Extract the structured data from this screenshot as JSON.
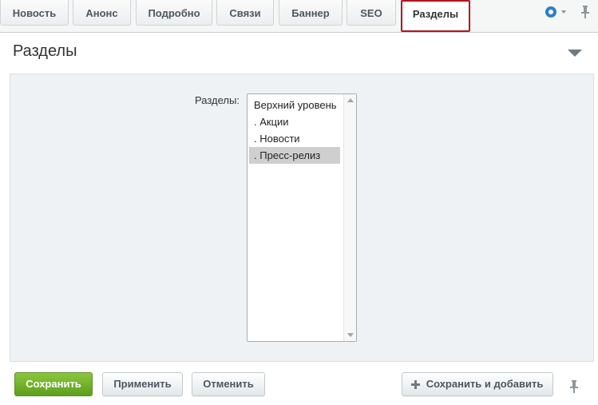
{
  "tabs": [
    {
      "label": "Новость",
      "active": false
    },
    {
      "label": "Анонс",
      "active": false
    },
    {
      "label": "Подробно",
      "active": false
    },
    {
      "label": "Связи",
      "active": false
    },
    {
      "label": "Баннер",
      "active": false
    },
    {
      "label": "SEO",
      "active": false
    },
    {
      "label": "Разделы",
      "active": true
    }
  ],
  "icons": {
    "settings": "gear-icon",
    "pin": "pin-icon",
    "collapse": "triangle-down-icon",
    "add": "plus-icon"
  },
  "section": {
    "title": "Разделы",
    "field_label": "Разделы:",
    "options": [
      {
        "label": "Верхний уровень",
        "selected": false
      },
      {
        "label": ". Акции",
        "selected": false
      },
      {
        "label": ". Новости",
        "selected": false
      },
      {
        "label": ". Пресс-релиз",
        "selected": true
      }
    ]
  },
  "footer": {
    "save_label": "Сохранить",
    "apply_label": "Применить",
    "cancel_label": "Отменить",
    "save_add_label": "Сохранить и добавить"
  },
  "colors": {
    "accent": "#2f7fc8",
    "primary_button": "#6fae2a",
    "active_tab_border": "#b5121b",
    "panel_bg": "#eef2f4"
  }
}
